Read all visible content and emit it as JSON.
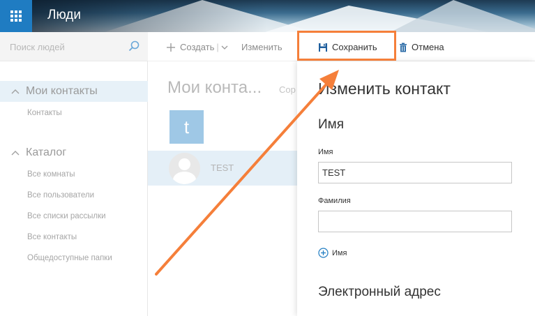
{
  "header": {
    "app_title": "Люди",
    "icons": {
      "app_launcher": "waffle-grid-icon"
    },
    "colors": {
      "launcher_bg": "#1f7cc2"
    }
  },
  "sidebar": {
    "search_placeholder": "Поиск людей",
    "sections": [
      {
        "label": "Мои контакты",
        "selected": true,
        "items": [
          {
            "label": "Контакты"
          }
        ]
      },
      {
        "label": "Каталог",
        "selected": false,
        "items": [
          {
            "label": "Все комнаты"
          },
          {
            "label": "Все пользователи"
          },
          {
            "label": "Все списки рассылки"
          },
          {
            "label": "Все контакты"
          },
          {
            "label": "Общедоступные папки"
          }
        ]
      }
    ]
  },
  "toolbar": {
    "create_label": "Создать",
    "edit_label": "Изменить",
    "save_label": "Сохранить",
    "cancel_label": "Отмена"
  },
  "list": {
    "title": "Мои конта...",
    "sort_label": "Сор",
    "letter_group": "t",
    "contacts": [
      {
        "name": "TEST"
      }
    ]
  },
  "form": {
    "title": "Изменить контакт",
    "name_section": "Имя",
    "first_name_label": "Имя",
    "first_name_value": "TEST",
    "last_name_label": "Фамилия",
    "last_name_value": "",
    "add_name_label": "Имя",
    "email_section": "Электронный адрес"
  },
  "annotation": {
    "highlight_color": "#f57f3a"
  }
}
